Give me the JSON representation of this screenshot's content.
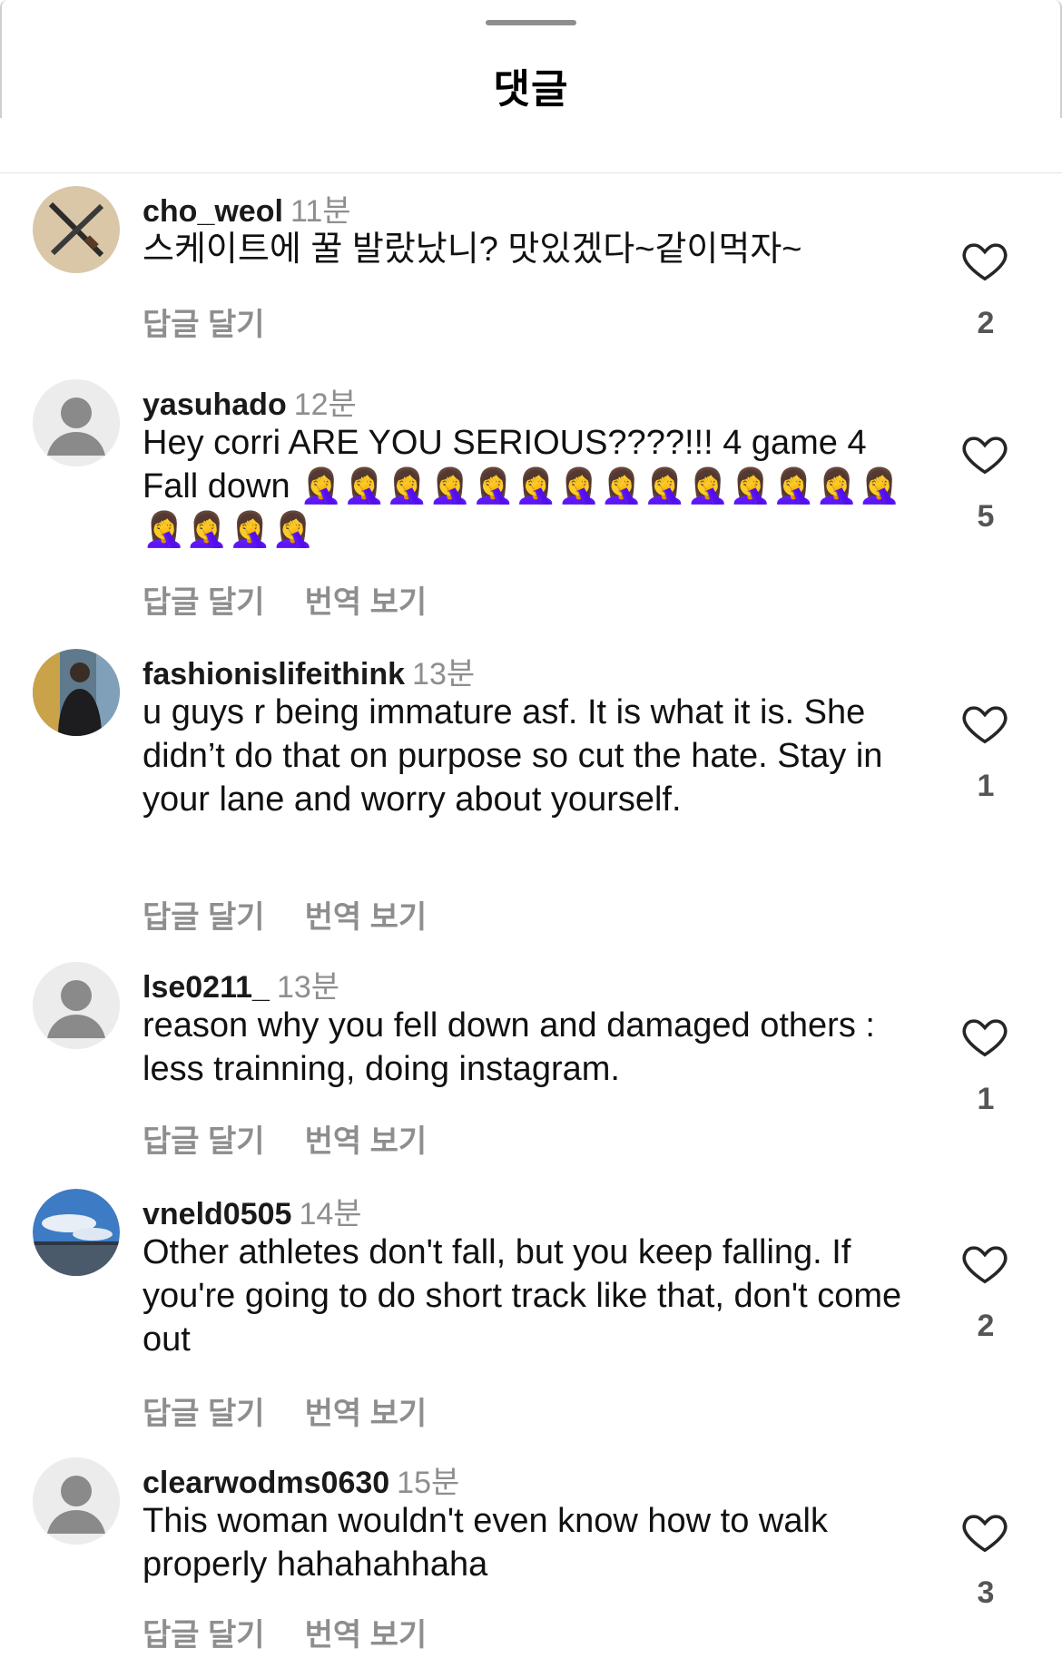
{
  "header": {
    "title": "댓글"
  },
  "reply_label": "답글 달기",
  "translate_label": "번역 보기",
  "comments": [
    {
      "username": "cho_weol",
      "time": "11분",
      "text": "스케이트에 꿀 발랐났니? 맛있겠다~같이먹자~",
      "likes": "2",
      "avatar": "photo-knives"
    },
    {
      "username": "yasuhado",
      "time": "12분",
      "text": "Hey corri ARE YOU SERIOUS????!!! 4 game 4 Fall down 🤦‍♀️🤦‍♀️🤦‍♀️🤦‍♀️🤦‍♀️🤦‍♀️🤦‍♀️🤦‍♀️🤦‍♀️🤦‍♀️🤦‍♀️🤦‍♀️🤦‍♀️🤦‍♀️🤦‍♀️🤦‍♀️🤦‍♀️🤦‍♀️",
      "likes": "5",
      "avatar": "default-avatar"
    },
    {
      "username": "fashionislifeithink",
      "time": "13분",
      "text": "u guys r being immature asf. It is what it is. She didn’t do that on purpose so cut the hate. Stay in your lane and worry about yourself.",
      "likes": "1",
      "avatar": "photo-person"
    },
    {
      "username": "lse0211_",
      "time": "13분",
      "text": "reason why you fell down and damaged others : less trainning, doing instagram.",
      "likes": "1",
      "avatar": "default-avatar"
    },
    {
      "username": "vneld0505",
      "time": "14분",
      "text": "Other athletes don't fall, but you keep falling. If you're going to do short track like that, don't come out",
      "likes": "2",
      "avatar": "photo-sky"
    },
    {
      "username": "clearwodms0630",
      "time": "15분",
      "text": "This woman wouldn't even know how to walk properly hahahahhaha",
      "likes": "3",
      "avatar": "default-avatar"
    }
  ]
}
